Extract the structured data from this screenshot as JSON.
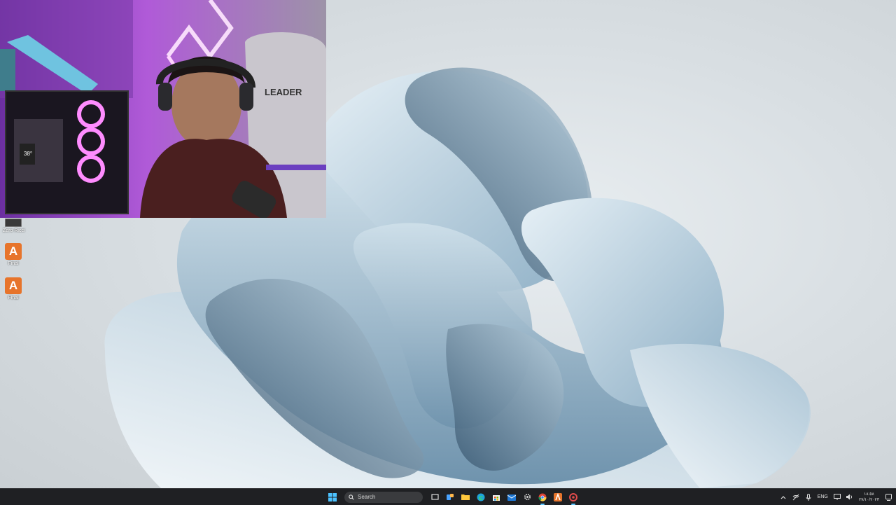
{
  "desktop": {
    "icons": [
      {
        "label": "Zero Ricci",
        "kind": "shortcut-small"
      },
      {
        "label": "Final",
        "kind": "app-a",
        "glyph": "A"
      },
      {
        "label": "Final",
        "kind": "app-a",
        "glyph": "A"
      }
    ]
  },
  "webcam": {
    "chair_brand": "LEADER",
    "temperature_display": "38°"
  },
  "taskbar": {
    "search_placeholder": "Search",
    "apps": [
      "start",
      "search",
      "task-view",
      "widgets",
      "file-explorer",
      "edge",
      "microsoft-store",
      "outlook",
      "settings",
      "chrome",
      "app-a",
      "app-red"
    ],
    "tray": {
      "language": "ENG",
      "time": "١٨:٥٨",
      "date": "٢٧/١٠/٢٠٢٣"
    }
  },
  "colors": {
    "accent": "#5cc7ff",
    "taskbar_bg": "#1f2023",
    "app_a": "#e7742b"
  }
}
